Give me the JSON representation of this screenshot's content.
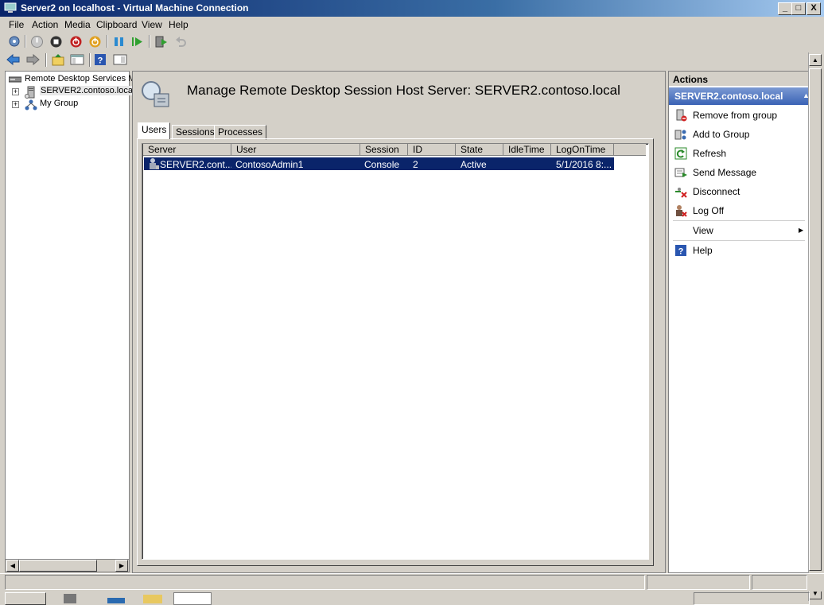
{
  "window": {
    "title": "Server2 on localhost - Virtual Machine Connection",
    "controls": {
      "minimize": "_",
      "maximize": "□",
      "close": "X"
    }
  },
  "menu": [
    "File",
    "Action",
    "Media",
    "Clipboard",
    "View",
    "Help"
  ],
  "tree": {
    "root": "Remote Desktop Services M",
    "items": [
      {
        "label": "SERVER2.contoso.loca",
        "expander": "+"
      },
      {
        "label": "My Group",
        "expander": "+"
      }
    ]
  },
  "main": {
    "heading": "Manage Remote Desktop Session Host Server: SERVER2.contoso.local",
    "tabs": [
      "Users",
      "Sessions",
      "Processes"
    ],
    "columns": [
      "Server",
      "User",
      "Session",
      "ID",
      "State",
      "IdleTime",
      "LogOnTime"
    ],
    "rows": [
      {
        "server": "SERVER2.cont...",
        "user": "ContosoAdmin1",
        "session": "Console",
        "id": "2",
        "state": "Active",
        "idletime": "",
        "logontime": "5/1/2016 8:..."
      }
    ]
  },
  "actions": {
    "header": "Actions",
    "subheader": "SERVER2.contoso.local",
    "items": [
      "Remove from group",
      "Add to Group",
      "Refresh",
      "Send Message",
      "Disconnect",
      "Log Off",
      "View",
      "Help"
    ]
  },
  "colors": {
    "selection": "#0a246a",
    "title_gradient_start": "#0a246a",
    "actions_sub": "#3a62b5"
  }
}
